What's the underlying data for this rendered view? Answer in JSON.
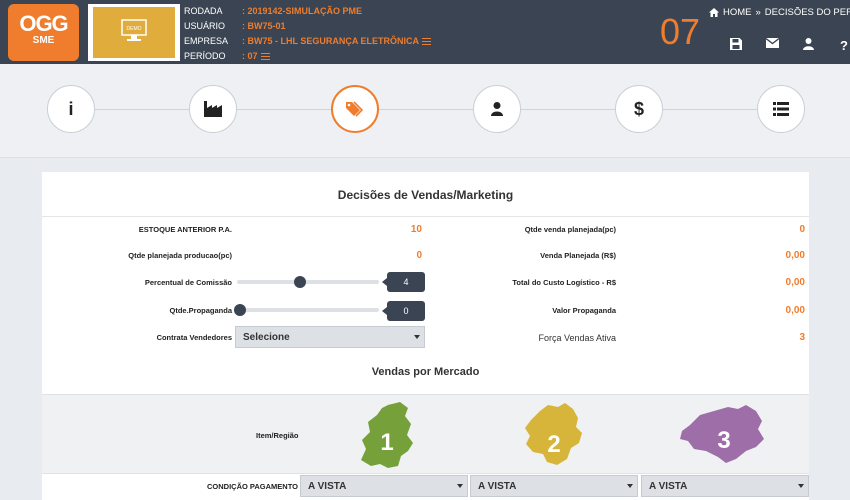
{
  "header": {
    "logo_line1": "OGG",
    "logo_line2": "SME",
    "rows": [
      {
        "label": "RODADA",
        "value": ": 2019142-SIMULAÇÃO PME"
      },
      {
        "label": "USUÁRIO",
        "value": ": BW75-01"
      },
      {
        "label": "EMPRESA",
        "value": ": BW75 - LHL SEGURANÇA ELETRÔNICA"
      },
      {
        "label": "PERÍODO",
        "value": ": 07"
      }
    ],
    "period_big": "07",
    "breadcrumb": {
      "home": "HOME",
      "sep": "»",
      "current": "DECISÕES DO PER..."
    },
    "icons": [
      "save-icon",
      "mail-icon",
      "user-icon",
      "help-icon"
    ],
    "help_glyph": "?"
  },
  "steps": [
    {
      "icon": "info-icon",
      "glyph": "i"
    },
    {
      "icon": "factory-icon"
    },
    {
      "icon": "tags-icon",
      "active": true
    },
    {
      "icon": "person-icon"
    },
    {
      "icon": "dollar-icon",
      "glyph": "$"
    },
    {
      "icon": "list-icon"
    }
  ],
  "panel": {
    "title": "Decisões de Vendas/Marketing",
    "left": {
      "estoque_label": "ESTOQUE ANTERIOR P.A.",
      "estoque_value": "10",
      "producao_label": "Qtde planejada producao(pc)",
      "producao_value": "0",
      "comissao_label": "Percentual de Comissão",
      "comissao_value": "4",
      "propaganda_label": "Qtde.Propaganda",
      "propaganda_value": "0",
      "vendedores_label": "Contrata Vendedores",
      "vendedores_select": "Selecione"
    },
    "right": {
      "venda_qtde_label": "Qtde venda planejada(pc)",
      "venda_qtde_value": "0",
      "venda_rs_label": "Venda Planejada (R$)",
      "venda_rs_value": "0,00",
      "custo_label": "Total do Custo Logístico - R$",
      "custo_value": "0,00",
      "propaganda_label": "Valor Propaganda",
      "propaganda_value": "0,00",
      "forca_label": "Força Vendas Ativa",
      "forca_value": "3"
    },
    "mercado_title": "Vendas por Mercado",
    "region_label": "Item/Região",
    "regions": [
      {
        "number": "1",
        "color": "#76a13a"
      },
      {
        "number": "2",
        "color": "#d7b43a"
      },
      {
        "number": "3",
        "color": "#9d6ea8"
      }
    ],
    "pagamento_label": "CONDIÇÃO PAGAMENTO",
    "pagamento_options": [
      "A VISTA",
      "A VISTA",
      "A VISTA"
    ]
  },
  "colors": {
    "accent": "#ef7d2d",
    "header_bg": "#3a4452"
  }
}
